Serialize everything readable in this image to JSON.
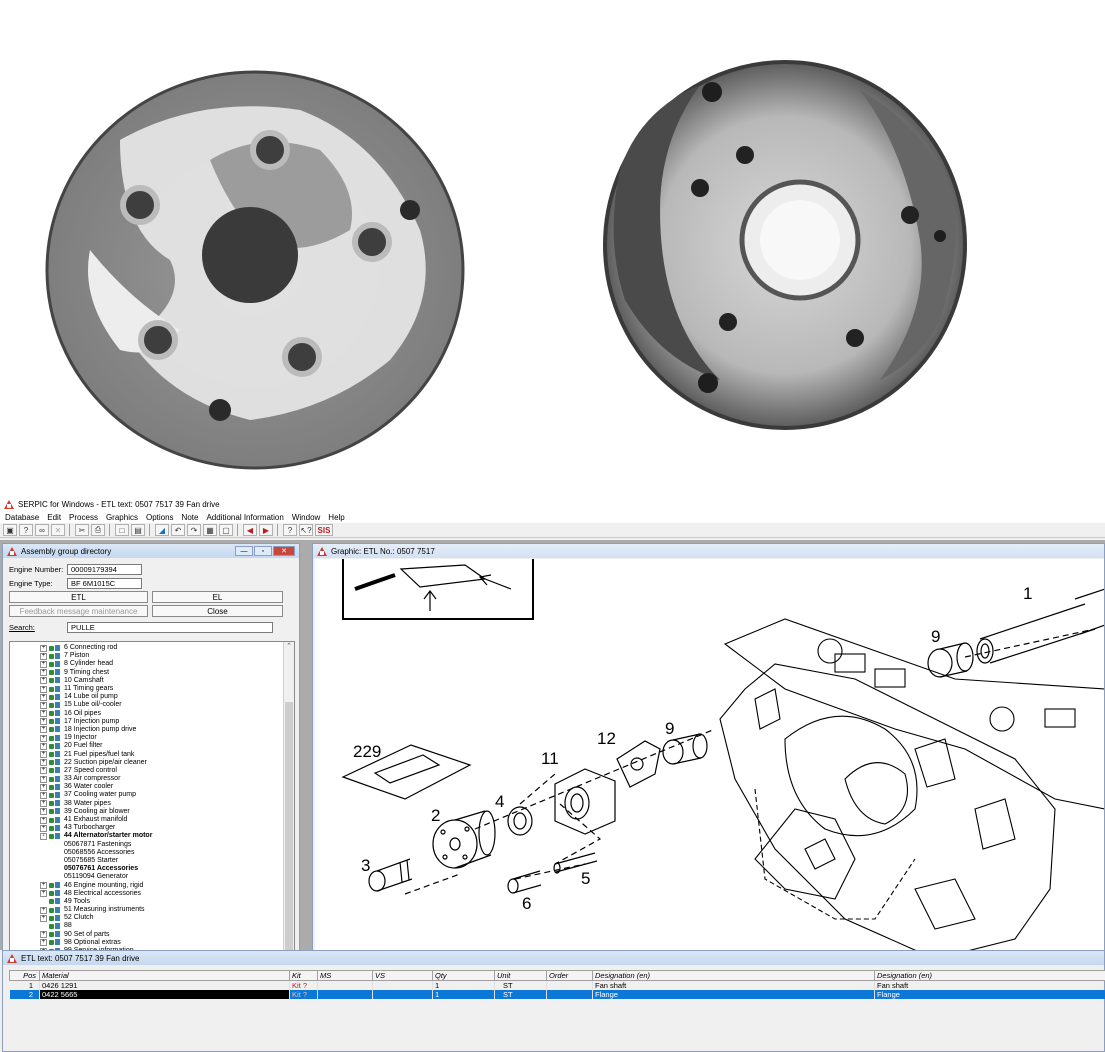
{
  "app": {
    "title": "SERPIC for Windows - ETL text: 0507 7517   39  Fan drive",
    "menu": [
      "Database",
      "Edit",
      "Process",
      "Graphics",
      "Options",
      "Note",
      "Additional Information",
      "Window",
      "Help"
    ],
    "toolbar_icons": [
      "open-icon",
      "find-icon",
      "link-icon",
      "cut-disabled-icon",
      "scissors-icon",
      "print-icon",
      "page-icon",
      "folder-icon",
      "paint-icon",
      "undo-icon",
      "redo-icon",
      "grid-icon",
      "zoom-icon",
      "arrow-left-icon",
      "arrow-right-icon",
      "help-icon",
      "context-help-icon",
      "sis-icon"
    ],
    "sis_label": "SIS"
  },
  "assembly": {
    "title": "Assembly group directory",
    "engine_number_label": "Engine Number:",
    "engine_number": "00009179394",
    "engine_type_label": "Engine Type:",
    "engine_type": "BF 6M1015C",
    "etl_button": "ETL",
    "el_button": "EL",
    "feedback_button": "Feedback message maintenance",
    "close_button": "Close",
    "search_label": "Search:",
    "search_value": "PULLE",
    "tree": [
      {
        "label": "6 Connecting rod",
        "level": 0,
        "icon": true,
        "exp": "+"
      },
      {
        "label": "7 Piston",
        "level": 0,
        "icon": true,
        "exp": "+"
      },
      {
        "label": "8 Cylinder head",
        "level": 0,
        "icon": true,
        "exp": "+"
      },
      {
        "label": "9 Timing chest",
        "level": 0,
        "icon": true,
        "exp": "+"
      },
      {
        "label": "10 Camshaft",
        "level": 0,
        "icon": true,
        "exp": "+"
      },
      {
        "label": "11 Timing gears",
        "level": 0,
        "icon": true,
        "exp": "+"
      },
      {
        "label": "14 Lube oil pump",
        "level": 0,
        "icon": true,
        "exp": "+"
      },
      {
        "label": "15 Lube oil/-cooler",
        "level": 0,
        "icon": true,
        "exp": "+"
      },
      {
        "label": "16 Oil pipes",
        "level": 0,
        "icon": true,
        "exp": "+"
      },
      {
        "label": "17 Injection pump",
        "level": 0,
        "icon": true,
        "exp": "+"
      },
      {
        "label": "18 Injection pump drive",
        "level": 0,
        "icon": true,
        "exp": "+"
      },
      {
        "label": "19 Injector",
        "level": 0,
        "icon": true,
        "exp": "+"
      },
      {
        "label": "20 Fuel filter",
        "level": 0,
        "icon": true,
        "exp": "+"
      },
      {
        "label": "21 Fuel pipes/fuel tank",
        "level": 0,
        "icon": true,
        "exp": "+"
      },
      {
        "label": "22 Suction pipe/air cleaner",
        "level": 0,
        "icon": true,
        "exp": "+"
      },
      {
        "label": "27 Speed control",
        "level": 0,
        "icon": true,
        "exp": "+"
      },
      {
        "label": "33 Air compressor",
        "level": 0,
        "icon": true,
        "exp": "+"
      },
      {
        "label": "36 Water cooler",
        "level": 0,
        "icon": true,
        "exp": "+"
      },
      {
        "label": "37 Cooling water pump",
        "level": 0,
        "icon": true,
        "exp": "+"
      },
      {
        "label": "38 Water pipes",
        "level": 0,
        "icon": true,
        "exp": "+"
      },
      {
        "label": "39 Cooling air blower",
        "level": 0,
        "icon": true,
        "exp": "+"
      },
      {
        "label": "41 Exhaust manifold",
        "level": 0,
        "icon": true,
        "exp": "+"
      },
      {
        "label": "43 Turbocharger",
        "level": 0,
        "icon": true,
        "exp": "+"
      },
      {
        "label": "44  Alternator/starter motor",
        "level": 0,
        "icon": true,
        "exp": "-",
        "bold": true
      },
      {
        "label": "05067871  Fastenings",
        "level": 1
      },
      {
        "label": "05068556  Accessories",
        "level": 1
      },
      {
        "label": "05075685  Starter",
        "level": 1
      },
      {
        "label": "05076761  Accessories",
        "level": 1,
        "bold": true
      },
      {
        "label": "05119094  Generator",
        "level": 1
      },
      {
        "label": "46 Engine mounting, rigid",
        "level": 0,
        "icon": true,
        "exp": "+"
      },
      {
        "label": "48 Electrical accessories",
        "level": 0,
        "icon": true,
        "exp": "+"
      },
      {
        "label": "49 Tools",
        "level": 0,
        "icon": true,
        "exp": ""
      },
      {
        "label": "51 Measuring instruments",
        "level": 0,
        "icon": true,
        "exp": "+"
      },
      {
        "label": "52 Clutch",
        "level": 0,
        "icon": true,
        "exp": "+"
      },
      {
        "label": "88",
        "level": 0,
        "icon": true,
        "exp": ""
      },
      {
        "label": "90 Set of parts",
        "level": 0,
        "icon": true,
        "exp": "+"
      },
      {
        "label": "98 Optional extras",
        "level": 0,
        "icon": true,
        "exp": "+"
      },
      {
        "label": "99 Service information",
        "level": 0,
        "icon": true,
        "exp": "+"
      }
    ]
  },
  "graphic": {
    "title": "Graphic: ETL No.: 0507 7517",
    "callouts": [
      "1",
      "9",
      "229",
      "11",
      "12",
      "9",
      "2",
      "4",
      "3",
      "6",
      "5"
    ]
  },
  "etl": {
    "title": "ETL text: 0507 7517   39  Fan drive",
    "columns": [
      "Pos",
      "Material",
      "Kit",
      "MS",
      "VS",
      "Qty",
      "Unit",
      "Order",
      "Designation (en)",
      "Designation (en)"
    ],
    "rows": [
      {
        "pos": "1",
        "material": "0426 1291",
        "kit": "Kit ?",
        "ms": "",
        "vs": "",
        "qty": "1",
        "unit": "ST",
        "order": "",
        "des1": "Fan shaft",
        "des2": "Fan shaft"
      },
      {
        "pos": "2",
        "material": "0422 5665",
        "kit": "Kit ?",
        "ms": "",
        "vs": "",
        "qty": "1",
        "unit": "ST",
        "order": "",
        "des1": "Flange",
        "des2": "Flange"
      }
    ]
  },
  "colors": {
    "accent": "#0b78d7",
    "mdi_background": "#ababab",
    "alert_red": "#d03a2a"
  }
}
